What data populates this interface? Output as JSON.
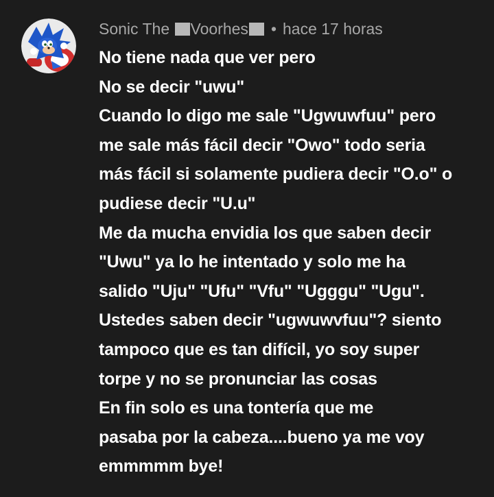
{
  "comment": {
    "author": {
      "name_prefix": "Sonic The ",
      "name_middle": "Voorhes",
      "avatar_icon": "sonic-avatar-icon"
    },
    "separator": "•",
    "timestamp": "hace 17 horas",
    "lines": [
      "No tiene nada que ver pero",
      "No se decir \"uwu\"",
      "Cuando lo digo me sale \"Ugwuwfuu\" pero",
      "me sale más fácil decir \"Owo\" todo seria",
      "más fácil si solamente pudiera decir \"O.o\" o",
      "pudiese decir \"U.u\"",
      "Me da mucha envidia los que saben decir",
      "\"Uwu\" ya lo he intentado y solo me ha",
      "salido \"Uju\" \"Ufu\" \"Vfu\" \"Ugggu\" \"Ugu\".",
      "Ustedes saben decir \"ugwuwvfuu\"? siento",
      "tampoco que es tan difícil, yo soy super",
      "torpe y no se pronunciar las cosas",
      "En fin solo es una tontería que me",
      "pasaba por la cabeza....bueno ya me voy",
      "emmmmm bye!"
    ]
  },
  "colors": {
    "background": "#1c1c1c",
    "meta_text": "#a8a8a8",
    "body_text": "#ffffff",
    "redaction": "#b8b8b8"
  }
}
